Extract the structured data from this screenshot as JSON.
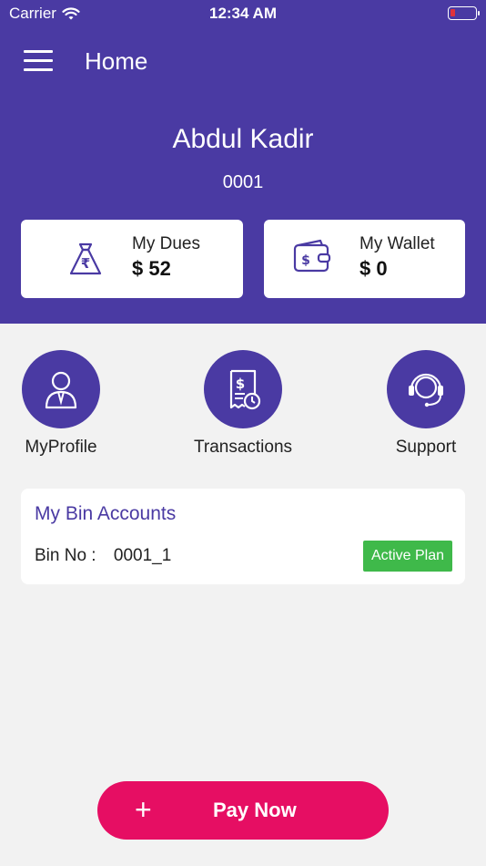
{
  "status_bar": {
    "carrier": "Carrier",
    "time": "12:34 AM"
  },
  "nav": {
    "title": "Home"
  },
  "user": {
    "name": "Abdul Kadir",
    "id": "0001"
  },
  "cards": {
    "dues": {
      "label": "My Dues",
      "value": "$ 52"
    },
    "wallet": {
      "label": "My Wallet",
      "value": "$ 0"
    }
  },
  "actions": [
    {
      "label": "MyProfile",
      "icon": "user-icon"
    },
    {
      "label": "Transactions",
      "icon": "receipt-icon"
    },
    {
      "label": "Support",
      "icon": "headset-icon"
    }
  ],
  "bin_accounts": {
    "title": "My Bin Accounts",
    "bin_no_label": "Bin No :",
    "bin_no": "0001_1",
    "status": "Active Plan"
  },
  "pay_button": {
    "icon": "plus-icon",
    "label": "Pay Now"
  },
  "colors": {
    "primary": "#4a3aa3",
    "accent": "#e60e63",
    "success": "#3fb94a",
    "background": "#f2f2f2"
  }
}
